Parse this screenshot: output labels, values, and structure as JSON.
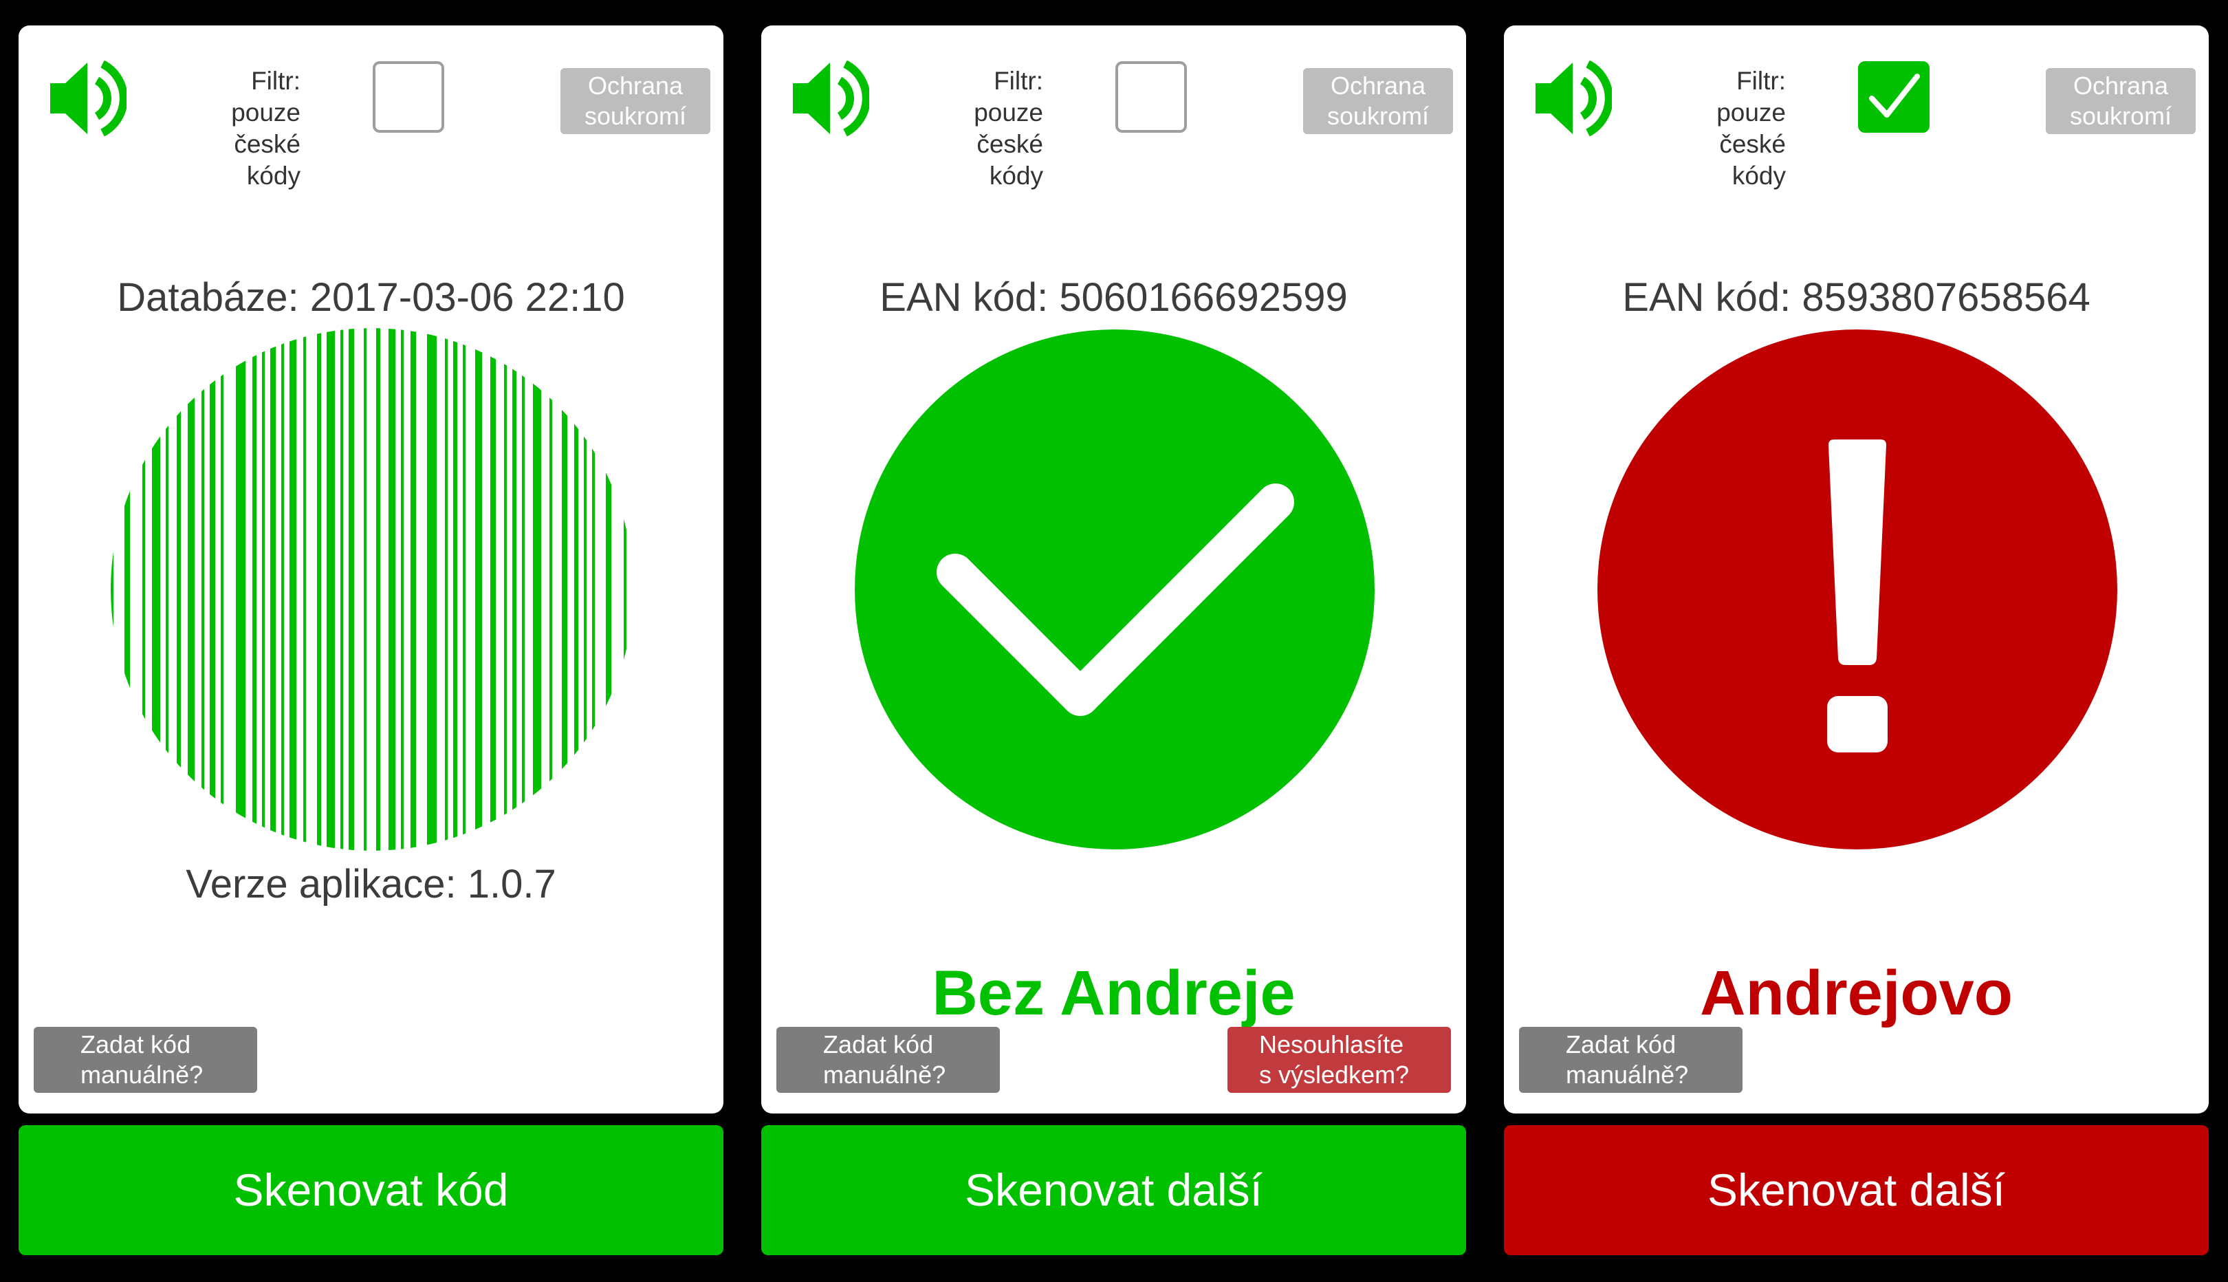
{
  "colors": {
    "green": "#00c000",
    "red": "#c00000",
    "disagree_red": "#c13b3e",
    "gray_button": "#7d7d7d",
    "light_gray_button": "#bdbdbd",
    "background": "#000000"
  },
  "screens": [
    {
      "state": "idle",
      "speaker_icon": "speaker-volume-icon",
      "filter_label_line1": "Filtr: pouze",
      "filter_label_line2": "české kódy",
      "filter_checked": false,
      "privacy_line1": "Ochrana",
      "privacy_line2": "soukromí",
      "top_text": "Databáze: 2017-03-06 22:10",
      "graphic_icon": "barcode-circle-icon",
      "bottom_text": "Verze aplikace: 1.0.7",
      "manual_line1": "Zadat kód",
      "manual_line2": "manuálně?",
      "main_button": "Skenovat kód",
      "main_button_color": "#00c000"
    },
    {
      "state": "ok",
      "speaker_icon": "speaker-volume-icon",
      "filter_label_line1": "Filtr: pouze",
      "filter_label_line2": "české kódy",
      "filter_checked": false,
      "privacy_line1": "Ochrana",
      "privacy_line2": "soukromí",
      "top_text": "EAN kód: 5060166692599",
      "graphic_icon": "checkmark-circle-icon",
      "verdict": "Bez Andreje",
      "verdict_color": "#00c000",
      "manual_line1": "Zadat kód",
      "manual_line2": "manuálně?",
      "disagree_line1": "Nesouhlasíte",
      "disagree_line2": "s výsledkem?",
      "main_button": "Skenovat další",
      "main_button_color": "#00c000"
    },
    {
      "state": "warning",
      "speaker_icon": "speaker-volume-icon",
      "filter_label_line1": "Filtr: pouze",
      "filter_label_line2": "české kódy",
      "filter_checked": true,
      "privacy_line1": "Ochrana",
      "privacy_line2": "soukromí",
      "top_text": "EAN kód: 8593807658564",
      "graphic_icon": "exclamation-circle-icon",
      "verdict": "Andrejovo",
      "verdict_color": "#c00000",
      "manual_line1": "Zadat kód",
      "manual_line2": "manuálně?",
      "main_button": "Skenovat další",
      "main_button_color": "#c00000"
    }
  ]
}
